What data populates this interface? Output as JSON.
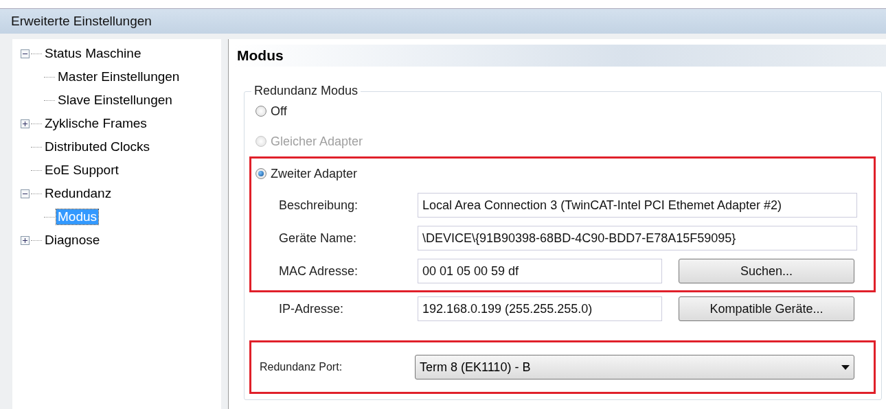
{
  "window": {
    "title": "Erweiterte Einstellungen"
  },
  "tree": [
    {
      "label": "Status Maschine",
      "expanded": true,
      "selected": false,
      "children": [
        {
          "label": "Master Einstellungen",
          "selected": false
        },
        {
          "label": "Slave Einstellungen",
          "selected": false
        }
      ]
    },
    {
      "label": "Zyklische Frames",
      "expanded": false,
      "selected": false
    },
    {
      "label": "Distributed Clocks",
      "selected": false
    },
    {
      "label": "EoE Support",
      "selected": false
    },
    {
      "label": "Redundanz",
      "expanded": true,
      "selected": false,
      "children": [
        {
          "label": "Modus",
          "selected": true
        }
      ]
    },
    {
      "label": "Diagnose",
      "expanded": false,
      "selected": false
    }
  ],
  "panel": {
    "title": "Modus",
    "group": {
      "title": "Redundanz Modus",
      "radios": [
        {
          "label": "Off",
          "selected": false,
          "disabled": false
        },
        {
          "label": "Gleicher Adapter",
          "selected": false,
          "disabled": true
        },
        {
          "label": "Zweiter Adapter",
          "selected": true,
          "disabled": false
        }
      ],
      "fields": [
        {
          "label": "Beschreibung:",
          "value": "Local Area Connection 3 (TwinCAT-Intel PCI Ethemet Adapter #2)"
        },
        {
          "label": "Geräte Name:",
          "value": "\\DEVICE\\{91B90398-68BD-4C90-BDD7-E78A15F59095}"
        },
        {
          "label": "MAC Adresse:",
          "value": "00 01 05 00 59 df",
          "button": "Suchen..."
        },
        {
          "label": "IP-Adresse:",
          "value": "192.168.0.199 (255.255.255.0)",
          "button": "Kompatible Geräte..."
        }
      ],
      "port": {
        "label": "Redundanz Port:",
        "value": "Term 8 (EK1110) - B"
      }
    }
  }
}
